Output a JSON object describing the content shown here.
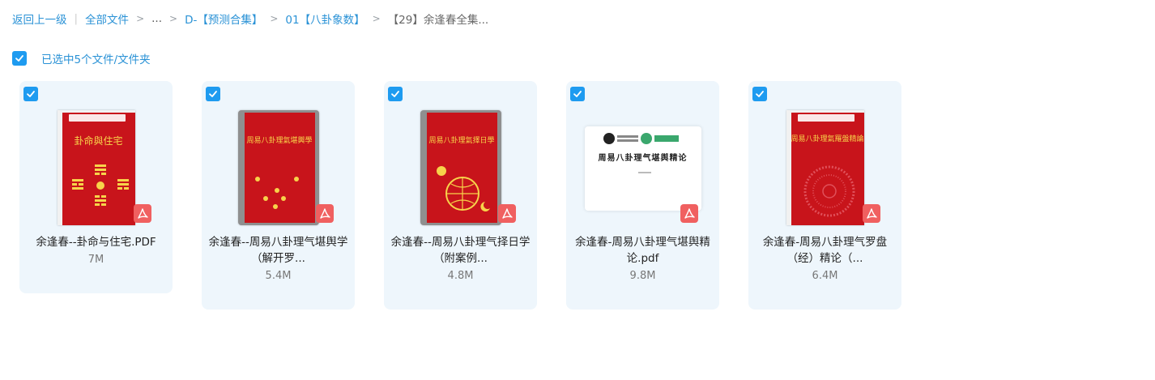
{
  "breadcrumb": {
    "back": "返回上一级",
    "root": "全部文件",
    "ellipsis": "...",
    "level1": "D-【预测合集】",
    "level2": "01【八卦象数】",
    "current": "【29】余逢春全集..."
  },
  "selection": {
    "text": "已选中5个文件/文件夹",
    "checked": true
  },
  "files": [
    {
      "name": "余逢春--卦命与住宅.PDF",
      "size": "7M",
      "type": "pdf",
      "cover_title": "卦命與住宅"
    },
    {
      "name": "余逢春--周易八卦理气堪舆学（解开罗...",
      "size": "5.4M",
      "type": "pdf",
      "cover_title": "周易八卦理氣堪輿學"
    },
    {
      "name": "余逢春--周易八卦理气择日学（附案例...",
      "size": "4.8M",
      "type": "pdf",
      "cover_title": "周易八卦理氣擇日學"
    },
    {
      "name": "余逢春-周易八卦理气堪舆精论.pdf",
      "size": "9.8M",
      "type": "pdf",
      "cover_title": "周易八卦理气堪舆精论"
    },
    {
      "name": "余逢春-周易八卦理气罗盘（经）精论（...",
      "size": "6.4M",
      "type": "pdf",
      "cover_title": "周易八卦理氣羅盤精論"
    }
  ],
  "colors": {
    "accent": "#1e9bf0",
    "link": "#2a92d6",
    "card_bg": "#eef6fc",
    "cover_red": "#c8141b",
    "pdf_badge": "#f06060"
  }
}
